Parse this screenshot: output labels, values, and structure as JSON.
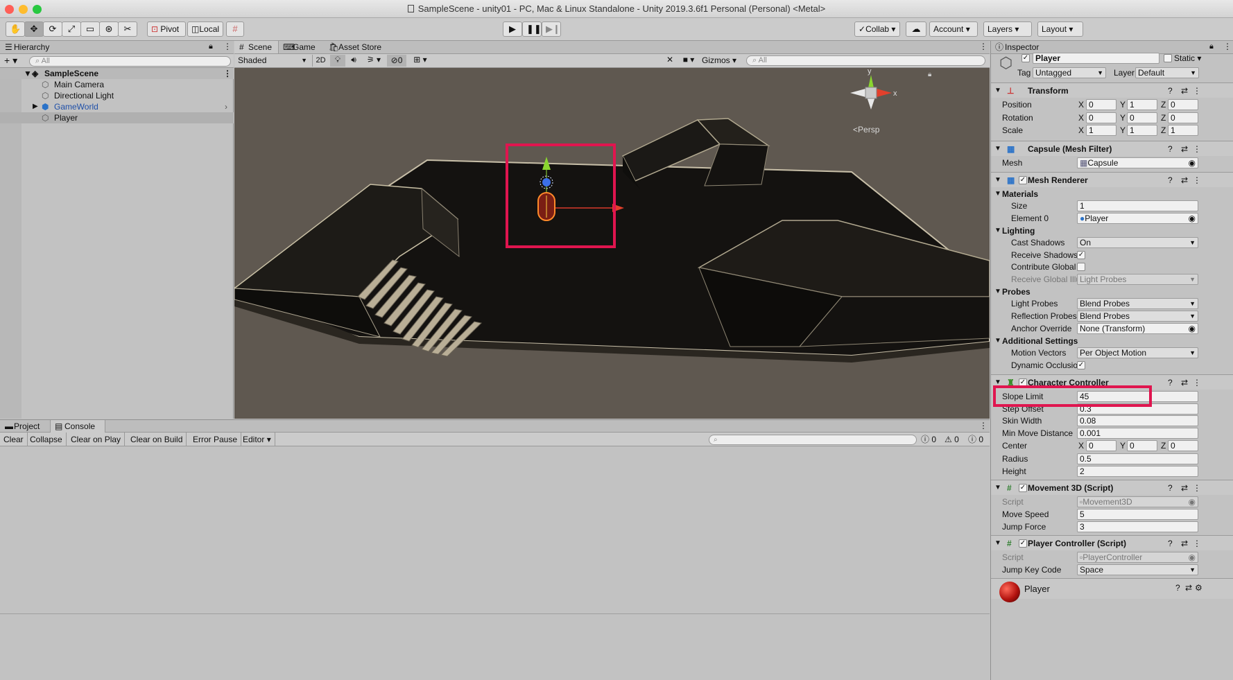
{
  "window": {
    "title": "SampleScene - unity01 - PC, Mac & Linux Standalone - Unity 2019.3.6f1 Personal (Personal) <Metal>"
  },
  "toolbar": {
    "tools": [
      "hand-tool",
      "move-tool",
      "rotate-tool",
      "scale-tool",
      "rect-tool",
      "transform-tool",
      "custom-tool"
    ],
    "pivot_label": "Pivot",
    "local_label": "Local",
    "collab_label": "Collab",
    "account_label": "Account",
    "layers_label": "Layers",
    "layout_label": "Layout"
  },
  "hierarchy": {
    "tab": "Hierarchy",
    "search_placeholder": "All",
    "scene_name": "SampleScene",
    "items": [
      {
        "label": "Main Camera"
      },
      {
        "label": "Directional Light"
      },
      {
        "label": "GameWorld"
      },
      {
        "label": "Player"
      }
    ]
  },
  "scene_view": {
    "tabs": [
      "Scene",
      "Game",
      "Asset Store"
    ],
    "shading": "Shaded",
    "mode_2d": "2D",
    "hidden_count": "0",
    "gizmos": "Gizmos",
    "search_placeholder": "All",
    "persp_label": "Persp",
    "axis_y": "y",
    "axis_x": "x"
  },
  "console": {
    "tabs": [
      "Project",
      "Console"
    ],
    "buttons": [
      "Clear",
      "Collapse",
      "Clear on Play",
      "Clear on Build",
      "Error Pause",
      "Editor"
    ],
    "log_count": "0",
    "warn_count": "0",
    "error_count": "0"
  },
  "inspector": {
    "tab": "Inspector",
    "object_name": "Player",
    "static_label": "Static",
    "tag_label": "Tag",
    "tag_value": "Untagged",
    "layer_label": "Layer",
    "layer_value": "Default",
    "transform": {
      "title": "Transform",
      "position_label": "Position",
      "position": [
        "0",
        "1",
        "0"
      ],
      "rotation_label": "Rotation",
      "rotation": [
        "0",
        "0",
        "0"
      ],
      "scale_label": "Scale",
      "scale": [
        "1",
        "1",
        "1"
      ]
    },
    "mesh_filter": {
      "title": "Capsule (Mesh Filter)",
      "mesh_label": "Mesh",
      "mesh_value": "Capsule"
    },
    "mesh_renderer": {
      "title": "Mesh Renderer",
      "materials_label": "Materials",
      "size_label": "Size",
      "size_value": "1",
      "element0_label": "Element 0",
      "element0_value": "Player",
      "lighting_label": "Lighting",
      "cast_shadows_label": "Cast Shadows",
      "cast_shadows_value": "On",
      "receive_shadows_label": "Receive Shadows",
      "contribute_gi_label": "Contribute Global Il",
      "receive_gi_label": "Receive Global Illu",
      "receive_gi_value": "Light Probes",
      "probes_label": "Probes",
      "light_probes_label": "Light Probes",
      "light_probes_value": "Blend Probes",
      "reflection_probes_label": "Reflection Probes",
      "reflection_probes_value": "Blend Probes",
      "anchor_override_label": "Anchor Override",
      "anchor_override_value": "None (Transform)",
      "additional_label": "Additional Settings",
      "motion_vectors_label": "Motion Vectors",
      "motion_vectors_value": "Per Object Motion",
      "dynamic_occlusion_label": "Dynamic Occlusion"
    },
    "character_controller": {
      "title": "Character Controller",
      "slope_limit_label": "Slope Limit",
      "slope_limit_value": "45",
      "step_offset_label": "Step Offset",
      "step_offset_value": "0.3",
      "skin_width_label": "Skin Width",
      "skin_width_value": "0.08",
      "min_move_label": "Min Move Distance",
      "min_move_value": "0.001",
      "center_label": "Center",
      "center": [
        "0",
        "0",
        "0"
      ],
      "radius_label": "Radius",
      "radius_value": "0.5",
      "height_label": "Height",
      "height_value": "2"
    },
    "movement3d": {
      "title": "Movement 3D (Script)",
      "script_label": "Script",
      "script_value": "Movement3D",
      "move_speed_label": "Move Speed",
      "move_speed_value": "5",
      "jump_force_label": "Jump Force",
      "jump_force_value": "3"
    },
    "player_controller": {
      "title": "Player Controller (Script)",
      "script_label": "Script",
      "script_value": "PlayerController",
      "jump_key_label": "Jump Key Code",
      "jump_key_value": "Space"
    },
    "material_preview": {
      "name": "Player"
    }
  },
  "colors": {
    "highlight": "#e0154f",
    "viewport_bg": "#5f5850",
    "selected_row": "#b0b0b0"
  }
}
